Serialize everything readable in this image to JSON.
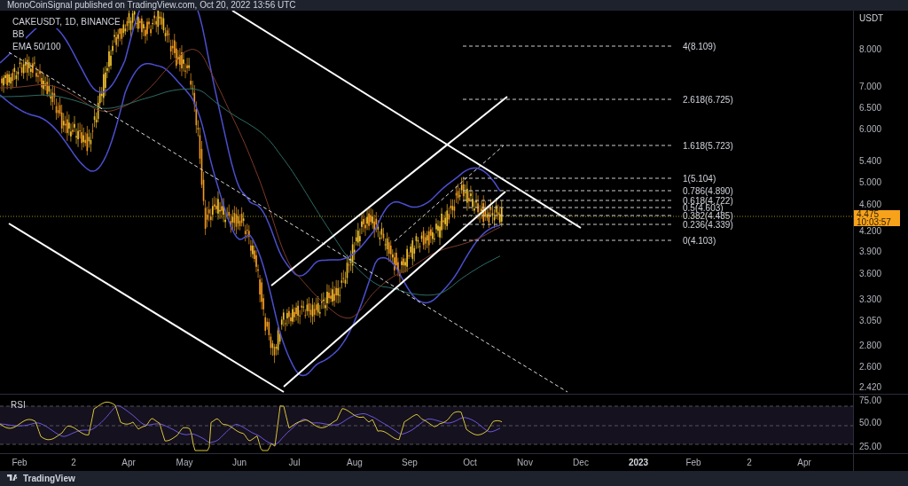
{
  "header": {
    "text": "MonoCoinSignal published on TradingView.com, Oct 20, 2022 13:56 UTC"
  },
  "legend": [
    "CAKEUSDT, 1D, BINANCE",
    "BB",
    "EMA 50/100"
  ],
  "price_axis": {
    "unit": "USDT",
    "labels": [
      "8.000",
      "7.000",
      "6.500",
      "6.000",
      "5.400",
      "5.000",
      "4.600",
      "4.200",
      "3.900",
      "3.600",
      "3.300",
      "3.050",
      "2.800",
      "2.600",
      "2.420"
    ]
  },
  "last_price": {
    "price": "4.475",
    "countdown": "10:03:57"
  },
  "fib_levels": [
    "4(8.109)",
    "2.618(6.725)",
    "1.618(5.723)",
    "1(5.104)",
    "0.786(4.890)",
    "0.618(4.722)",
    "0.5(4.603)",
    "0.382(4.485)",
    "0.236(4.339)",
    "0(4.103)"
  ],
  "rsi": {
    "label": "RSI",
    "axis_labels": [
      "75.00",
      "50.00",
      "25.00"
    ]
  },
  "time_axis": [
    {
      "label": "Feb",
      "bold": false
    },
    {
      "label": "2",
      "bold": false
    },
    {
      "label": "Apr",
      "bold": false
    },
    {
      "label": "May",
      "bold": false
    },
    {
      "label": "Jun",
      "bold": false
    },
    {
      "label": "Jul",
      "bold": false
    },
    {
      "label": "Aug",
      "bold": false
    },
    {
      "label": "Sep",
      "bold": false
    },
    {
      "label": "Oct",
      "bold": false
    },
    {
      "label": "Nov",
      "bold": false
    },
    {
      "label": "Dec",
      "bold": false
    },
    {
      "label": "2023",
      "bold": true
    },
    {
      "label": "Feb",
      "bold": false
    },
    {
      "label": "2",
      "bold": false
    },
    {
      "label": "Apr",
      "bold": false
    }
  ],
  "footer": {
    "brand": "TradingView"
  }
}
